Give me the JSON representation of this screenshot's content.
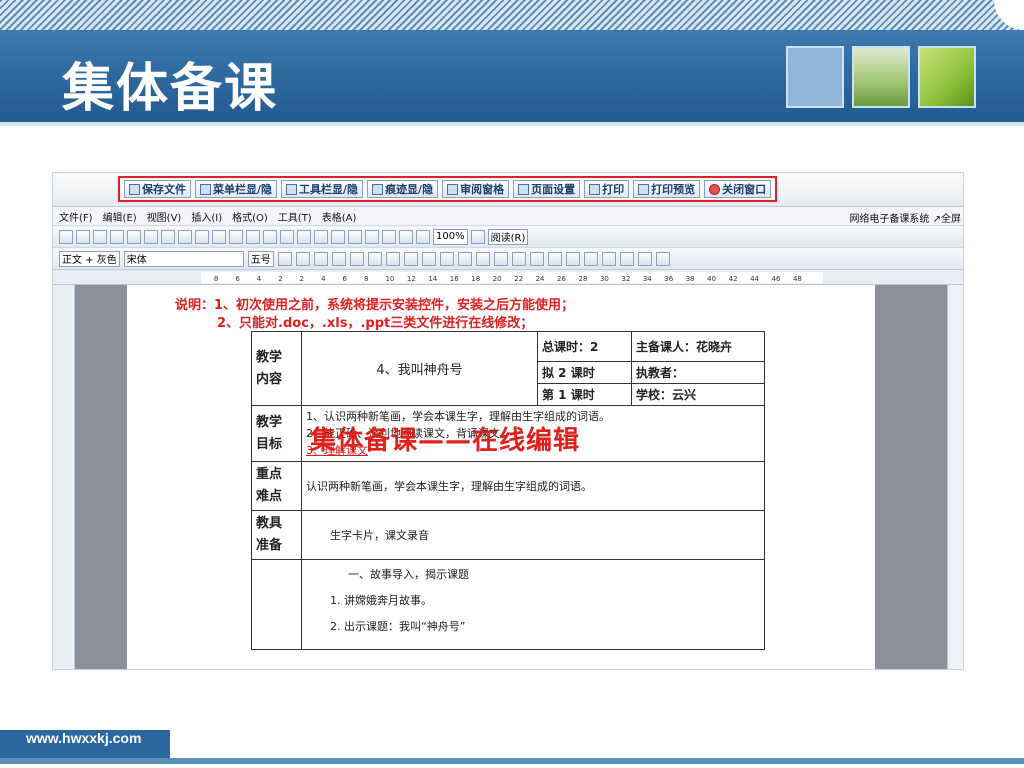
{
  "slide": {
    "title": "集体备课",
    "footer_url": "www.hwxxkj.com"
  },
  "toolbar_buttons": [
    {
      "label": "保存文件",
      "icon": "save-icon"
    },
    {
      "label": "菜单栏显/隐",
      "icon": "menu-icon"
    },
    {
      "label": "工具栏显/隐",
      "icon": "toolbar-icon"
    },
    {
      "label": "痕迹显/隐",
      "icon": "track-icon"
    },
    {
      "label": "审阅窗格",
      "icon": "review-icon"
    },
    {
      "label": "页面设置",
      "icon": "page-setup-icon"
    },
    {
      "label": "打印",
      "icon": "print-icon"
    },
    {
      "label": "打印预览",
      "icon": "print-preview-icon"
    },
    {
      "label": "关闭窗口",
      "icon": "close-icon"
    }
  ],
  "menu": {
    "items": [
      "文件(F)",
      "编辑(E)",
      "视图(V)",
      "插入(I)",
      "格式(O)",
      "工具(T)",
      "表格(A)"
    ],
    "right_text": "网络电子备课系统 ↗全屏"
  },
  "format": {
    "style": "正文 + 灰色",
    "font": "宋体",
    "size": "五号",
    "zoom": "100%",
    "read_label": "阅读(R)"
  },
  "ruler_ticks": [
    "8",
    "6",
    "4",
    "2",
    "2",
    "4",
    "6",
    "8",
    "10",
    "12",
    "14",
    "16",
    "18",
    "20",
    "22",
    "24",
    "26",
    "28",
    "30",
    "32",
    "34",
    "36",
    "38",
    "40",
    "42",
    "44",
    "46",
    "48"
  ],
  "note": {
    "line1": "说明：1、初次使用之前，系统将提示安装控件，安装之后方能使用；",
    "line2": "2、只能对.doc，.xls，.ppt三类文件进行在线修改；"
  },
  "lesson": {
    "content_label_1": "教学",
    "content_label_2": "内容",
    "content_value": "4、我叫神舟号",
    "total_hours": "总课时：2",
    "lead_preparer": "主备课人：花晓卉",
    "plan_hours": "拟 2  课时",
    "teacher": "执教者：",
    "session": "第  1 课时",
    "school": "学校：云兴",
    "goal_label_1": "教学",
    "goal_label_2": "目标",
    "goals": [
      "1、认识两种新笔画，学会本课生字，理解由生字组成的词语。",
      "2、能正确、流利地朗读课文，背诵课文。",
      "3、理解课文"
    ],
    "key_label_1": "重点",
    "key_label_2": "难点",
    "key_value": "认识两种新笔画，学会本课生字，理解由生字组成的词语。",
    "prep_label_1": "教具",
    "prep_label_2": "准备",
    "prep_value": "生字卡片，课文录音",
    "process": [
      "一、故事导入，揭示课题",
      "1. 讲嫦娥奔月故事。",
      "2. 出示课题：我叫“神舟号”"
    ]
  },
  "overlay_caption": "集体备课——在线编辑",
  "colors": {
    "title_bar": "#2f6aa0",
    "accent_red": "#e02020",
    "footer_blue": "#2a66a0"
  }
}
